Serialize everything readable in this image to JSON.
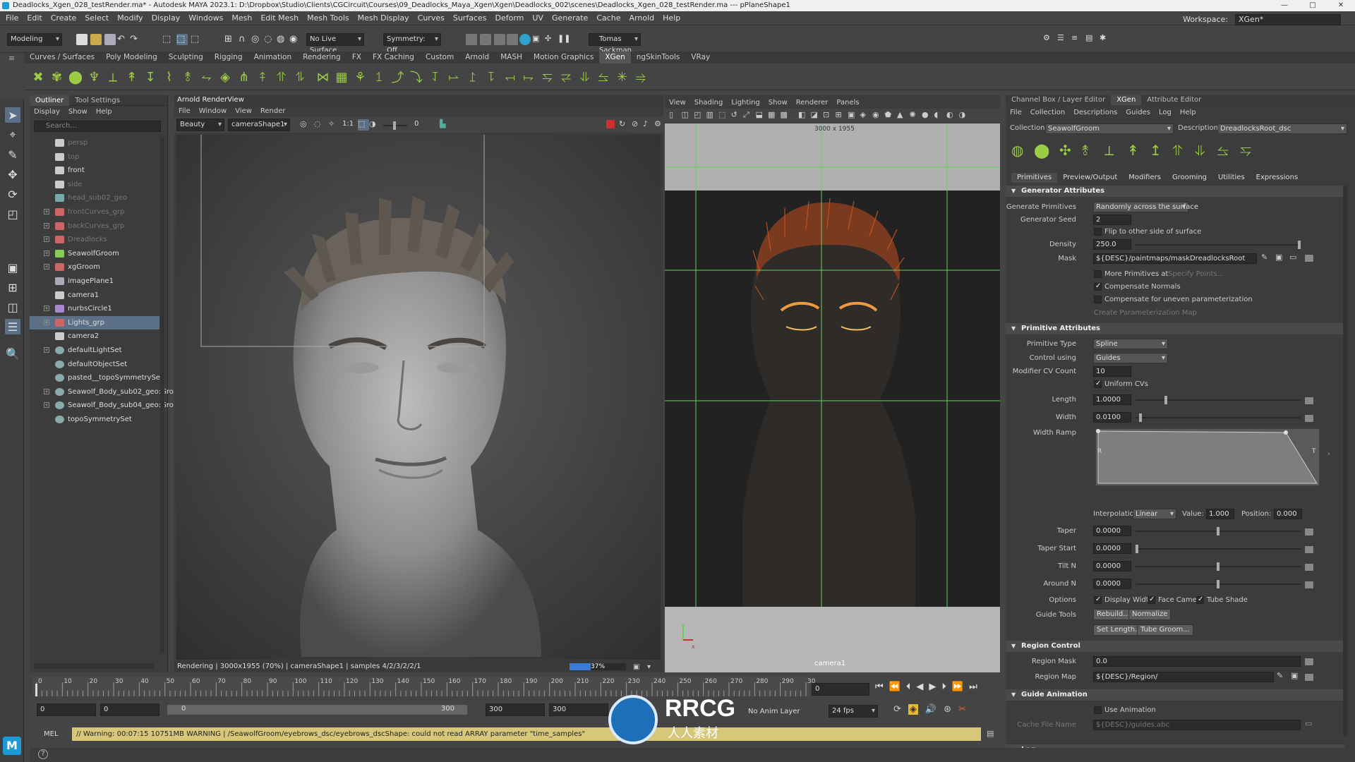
{
  "window": {
    "title": "Deadlocks_Xgen_028_testRender.ma* - Autodesk MAYA 2023.1: D:\\Dropbox\\Studio\\Clients\\CGCircuit\\Courses\\09_Deadlocks_Maya_Xgen\\Xgen\\Deadlocks_002\\scenes\\Deadlocks_Xgen_028_testRender.ma --- pPlaneShape1",
    "controls": [
      "—",
      "□",
      "✕"
    ]
  },
  "menubar": {
    "items": [
      "File",
      "Edit",
      "Create",
      "Select",
      "Modify",
      "Display",
      "Windows",
      "Mesh",
      "Edit Mesh",
      "Mesh Tools",
      "Mesh Display",
      "Curves",
      "Surfaces",
      "Deform",
      "UV",
      "Generate",
      "Cache",
      "Arnold",
      "Help"
    ],
    "workspace_label": "Workspace:",
    "workspace_value": "XGen*"
  },
  "statusline": {
    "mode": "Modeling",
    "live_surface": "No Live Surface",
    "symmetry": "Symmetry: Off",
    "user": "Tomas Sackman"
  },
  "shelf": {
    "tabs": [
      "Curves / Surfaces",
      "Poly Modeling",
      "Sculpting",
      "Rigging",
      "Animation",
      "Rendering",
      "FX",
      "FX Caching",
      "Custom",
      "Arnold",
      "MASH",
      "Motion Graphics",
      "XGen",
      "ngSkinTools",
      "VRay"
    ],
    "active_tab": "XGen"
  },
  "outliner": {
    "tabs": [
      "Outliner",
      "Tool Settings"
    ],
    "menu": [
      "Display",
      "Show",
      "Help"
    ],
    "search_placeholder": "Search...",
    "items": [
      {
        "label": "persp",
        "dim": true,
        "expand": false,
        "icon": "camera"
      },
      {
        "label": "top",
        "dim": true,
        "expand": false,
        "icon": "camera"
      },
      {
        "label": "front",
        "dim": false,
        "expand": false,
        "icon": "camera"
      },
      {
        "label": "side",
        "dim": true,
        "expand": false,
        "icon": "camera"
      },
      {
        "label": "head_sub02_geo",
        "dim": true,
        "expand": false,
        "icon": "mesh"
      },
      {
        "label": "frontCurves_grp",
        "dim": true,
        "expand": true,
        "icon": "group"
      },
      {
        "label": "backCurves_grp",
        "dim": true,
        "expand": true,
        "icon": "group"
      },
      {
        "label": "Dreadlocks",
        "dim": true,
        "expand": true,
        "icon": "group"
      },
      {
        "label": "SeawolfGroom",
        "dim": false,
        "expand": true,
        "icon": "xgen"
      },
      {
        "label": "xgGroom",
        "dim": false,
        "expand": true,
        "icon": "group"
      },
      {
        "label": "imagePlane1",
        "dim": false,
        "expand": false,
        "icon": "plane"
      },
      {
        "label": "camera1",
        "dim": false,
        "expand": false,
        "icon": "camera"
      },
      {
        "label": "nurbsCircle1",
        "dim": false,
        "expand": true,
        "icon": "curve"
      },
      {
        "label": "Lights_grp",
        "dim": false,
        "expand": true,
        "icon": "group",
        "selected": true
      },
      {
        "label": "camera2",
        "dim": false,
        "expand": false,
        "icon": "camera"
      },
      {
        "label": "defaultLightSet",
        "dim": false,
        "expand": true,
        "icon": "set"
      },
      {
        "label": "defaultObjectSet",
        "dim": false,
        "expand": false,
        "icon": "set"
      },
      {
        "label": "pasted__topoSymmetrySet",
        "dim": false,
        "expand": false,
        "icon": "set"
      },
      {
        "label": "Seawolf_Body_sub02_geo:Gro",
        "dim": false,
        "expand": true,
        "icon": "set"
      },
      {
        "label": "Seawolf_Body_sub04_geo:Gro",
        "dim": false,
        "expand": true,
        "icon": "set"
      },
      {
        "label": "topoSymmetrySet",
        "dim": false,
        "expand": false,
        "icon": "set"
      }
    ]
  },
  "renderview": {
    "title": "Arnold RenderView",
    "menu": [
      "File",
      "Window",
      "View",
      "Render"
    ],
    "aov": "Beauty",
    "camera": "cameraShape1",
    "ratio": "1:1",
    "exposure": "0",
    "status": "Rendering | 3000x1955 (70%) | cameraShape1 | samples 4/2/3/2/2/1",
    "progress_label": "37%",
    "progress": 0.37
  },
  "viewport": {
    "menu": [
      "View",
      "Shading",
      "Lighting",
      "Show",
      "Renderer",
      "Panels"
    ],
    "resolution": "3000 x 1955",
    "camera_label": "camera1",
    "axis_y": "y",
    "axis_x": "x"
  },
  "rightpanel": {
    "tabs": [
      "Channel Box / Layer Editor",
      "XGen",
      "Attribute Editor"
    ],
    "active_tab": "XGen",
    "menu": [
      "File",
      "Collection",
      "Descriptions",
      "Guides",
      "Log",
      "Help"
    ],
    "collection_label": "Collection",
    "collection": "SeawolfGroom",
    "description_label": "Description",
    "description": "DreadlocksRoot_dsc",
    "subtabs": [
      "Primitives",
      "Preview/Output",
      "Modifiers",
      "Grooming",
      "Utilities",
      "Expressions"
    ],
    "sections": {
      "generator": "Generator Attributes",
      "primitive": "Primitive Attributes",
      "region": "Region Control",
      "guide_anim": "Guide Animation",
      "log": "Log"
    },
    "gen": {
      "generate_primitives_label": "Generate Primitives",
      "generate_primitives": "Randomly across the surface",
      "seed_label": "Generator Seed",
      "seed": "2",
      "flip_label": "Flip to other side of surface",
      "density_label": "Density",
      "density": "250.0",
      "mask_label": "Mask",
      "mask": "${DESC}/paintmaps/maskDreadlocksRoot",
      "more_prims_label": "More Primitives at",
      "specify_points": "Specify Points...",
      "comp_normals_label": "Compensate Normals",
      "comp_uneven_label": "Compensate for uneven parameterization",
      "create_param_map": "Create Parameterization Map"
    },
    "prim": {
      "type_label": "Primitive Type",
      "type": "Spline",
      "control_label": "Control using",
      "control": "Guides",
      "cv_label": "Modifier CV Count",
      "cv": "10",
      "uniform_label": "Uniform CVs",
      "length_label": "Length",
      "length": "1.0000",
      "length_pos": 0.18,
      "width_label": "Width",
      "width": "0.0100",
      "width_pos": 0.02,
      "ramp_label": "Width Ramp",
      "ramp_left": "R",
      "ramp_right": "T",
      "interp_label": "Interpolation:",
      "interp": "Linear",
      "value_label": "Value:",
      "value": "1.000",
      "position_label": "Position:",
      "position": "0.000",
      "taper_label": "Taper",
      "taper": "0.0000",
      "taper_pos": 0.5,
      "taper_start_label": "Taper Start",
      "taper_start": "0.0000",
      "taper_start_pos": 0.0,
      "tilt_label": "Tilt N",
      "tilt": "0.0000",
      "tilt_pos": 0.5,
      "around_label": "Around N",
      "around": "0.0000",
      "around_pos": 0.5,
      "options_label": "Options",
      "display_width": "Display Width",
      "face_camera": "Face Camera",
      "tube_shade": "Tube Shade",
      "guide_tools_label": "Guide Tools",
      "rebuild": "Rebuild...",
      "normalize": "Normalize",
      "set_length": "Set Length...",
      "tube_groom": "Tube Groom..."
    },
    "region": {
      "mask_label": "Region Mask",
      "mask": "0.0",
      "map_label": "Region Map",
      "map": "${DESC}/Region/"
    },
    "anim": {
      "use_anim_label": "Use Animation",
      "cache_label": "Cache File Name",
      "cache": "${DESC}/guides.abc"
    }
  },
  "timeline": {
    "ticks": [
      "0",
      "10",
      "20",
      "30",
      "40",
      "50",
      "60",
      "70",
      "80",
      "90",
      "100",
      "110",
      "120",
      "130",
      "140",
      "150",
      "160",
      "170",
      "180",
      "190",
      "200",
      "210",
      "220",
      "230",
      "240",
      "250",
      "260",
      "270",
      "280",
      "290",
      "30"
    ],
    "current_frame": "0"
  },
  "range": {
    "start": "0",
    "start_inner": "0",
    "slider_start": "0",
    "slider_end": "300",
    "end_inner": "300",
    "end": "300",
    "anim_layer": "No Anim Layer",
    "fps": "24 fps"
  },
  "command": {
    "lang": "MEL",
    "warning": "// Warning: 00:07:15 10751MB WARNING | /SeawolfGroom/eyebrows_dsc/eyebrows_dscShape: could not read ARRAY parameter \"time_samples\""
  },
  "watermark": {
    "text": "RRCG",
    "sub": "人人素材"
  },
  "colors": {
    "accent_select": "#5b6f86",
    "xgen_green": "#9acd45",
    "warning_bg": "#d6c77a",
    "guide_green": "#5fd35f",
    "render_red": "#d0302f"
  }
}
